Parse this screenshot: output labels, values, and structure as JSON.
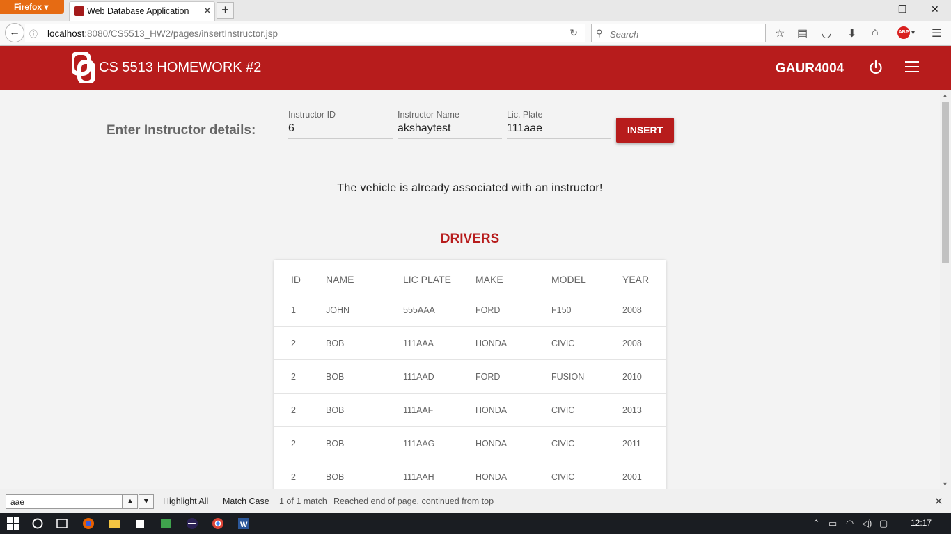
{
  "browser": {
    "app_menu": "Firefox",
    "tab_title": "Web Database Application",
    "url_host": "localhost",
    "url_path": ":8080/CS5513_HW2/pages/insertInstructor.jsp",
    "search_placeholder": "Search",
    "abp_label": "ABP"
  },
  "header": {
    "title": "CS 5513 HOMEWORK #2",
    "user": "GAUR4004",
    "brand_color": "#b71c1c"
  },
  "form": {
    "heading": "Enter Instructor details:",
    "fields": [
      {
        "label": "Instructor ID",
        "value": "6"
      },
      {
        "label": "Instructor Name",
        "value": "akshaytest"
      },
      {
        "label": "Lic. Plate",
        "value": "111aae"
      }
    ],
    "submit_label": "INSERT"
  },
  "message": "The vehicle is already associated with an instructor!",
  "table": {
    "title": "DRIVERS",
    "columns": [
      "ID",
      "NAME",
      "LIC PLATE",
      "MAKE",
      "MODEL",
      "YEAR"
    ],
    "rows": [
      [
        "1",
        "JOHN",
        "555AAA",
        "FORD",
        "F150",
        "2008"
      ],
      [
        "2",
        "BOB",
        "111AAA",
        "HONDA",
        "CIVIC",
        "2008"
      ],
      [
        "2",
        "BOB",
        "111AAD",
        "FORD",
        "FUSION",
        "2010"
      ],
      [
        "2",
        "BOB",
        "111AAF",
        "HONDA",
        "CIVIC",
        "2013"
      ],
      [
        "2",
        "BOB",
        "111AAG",
        "HONDA",
        "CIVIC",
        "2011"
      ],
      [
        "2",
        "BOB",
        "111AAH",
        "HONDA",
        "CIVIC",
        "2001"
      ]
    ]
  },
  "findbar": {
    "query": "aae",
    "highlight_all": "Highlight All",
    "match_case": "Match Case",
    "match_count": "1 of 1 match",
    "status": "Reached end of page, continued from top"
  },
  "taskbar": {
    "clock": "12:17"
  }
}
